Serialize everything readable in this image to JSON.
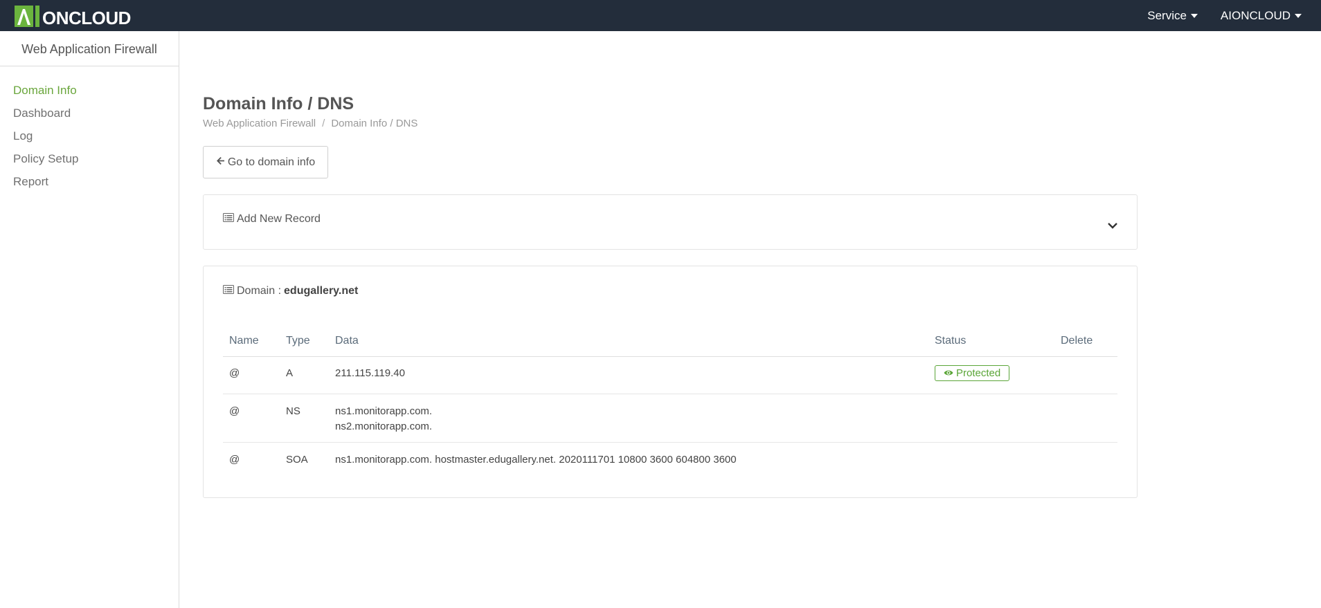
{
  "app": {
    "logo_text": "ONCLOUD",
    "brand_color": "#6bb43e",
    "topbar_color": "#232d3b"
  },
  "topnav": {
    "service_label": "Service",
    "account_label": "AIONCLOUD"
  },
  "sidebar": {
    "title": "Web Application Firewall",
    "items": [
      {
        "label": "Domain Info",
        "active": true
      },
      {
        "label": "Dashboard",
        "active": false
      },
      {
        "label": "Log",
        "active": false
      },
      {
        "label": "Policy Setup",
        "active": false
      },
      {
        "label": "Report",
        "active": false
      }
    ]
  },
  "page": {
    "title": "Domain Info / DNS",
    "breadcrumb": [
      "Web Application Firewall",
      "Domain Info / DNS"
    ],
    "breadcrumb_separator": "/",
    "back_button_label": "Go to domain info"
  },
  "add_record": {
    "label": "Add New Record"
  },
  "domain_panel": {
    "label": "Domain :",
    "domain": "edugallery.net",
    "columns": [
      "Name",
      "Type",
      "Data",
      "Status",
      "Delete"
    ],
    "rows": [
      {
        "name": "@",
        "type": "A",
        "data": [
          "211.115.119.40"
        ],
        "status": "Protected"
      },
      {
        "name": "@",
        "type": "NS",
        "data": [
          "ns1.monitorapp.com.",
          "ns2.monitorapp.com."
        ],
        "status": ""
      },
      {
        "name": "@",
        "type": "SOA",
        "data": [
          "ns1.monitorapp.com. hostmaster.edugallery.net. 2020111701 10800 3600 604800 3600"
        ],
        "status": ""
      }
    ]
  }
}
